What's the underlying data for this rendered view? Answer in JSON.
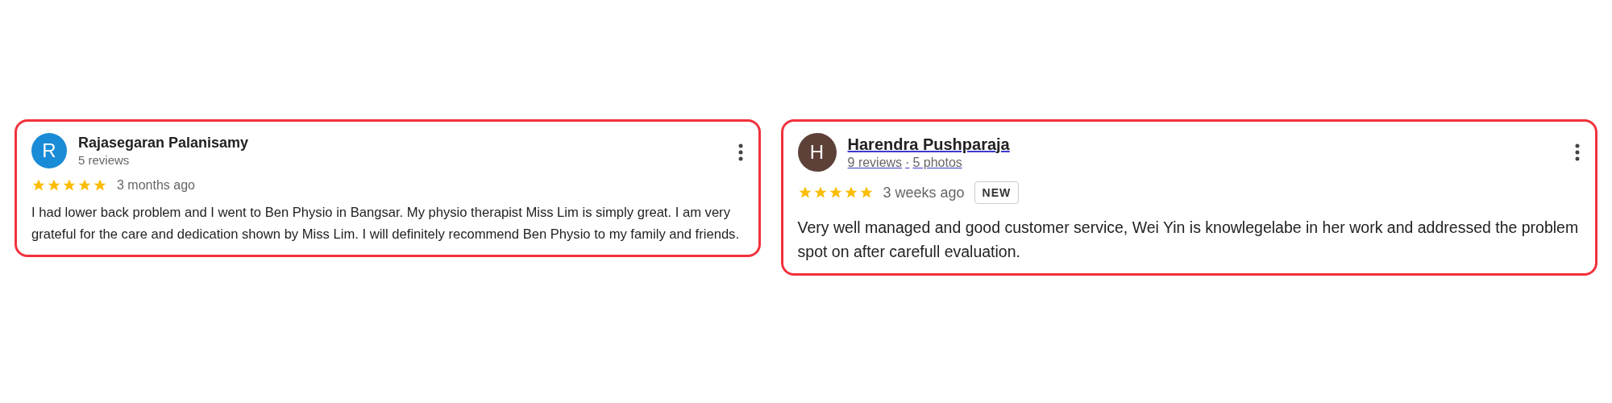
{
  "reviews": [
    {
      "avatar": {
        "letter": "R",
        "color": "#1a8bd6"
      },
      "name": "Rajasegaran Palanisamy",
      "linked": false,
      "meta": [
        "5 reviews"
      ],
      "stars": 5,
      "time": "3 months ago",
      "text": "I had lower back problem and I went to Ben Physio in Bangsar. My physio therapist Miss Lim is simply great. I am very grateful for the care and dedication shown by Miss Lim. I will definitely recommend Ben Physio to my family and friends.",
      "kind": "compact"
    },
    {
      "avatar": {
        "letter": "H",
        "color": "#5d4037"
      },
      "name": "Harendra Pushparaja",
      "linked": true,
      "meta": [
        "9 reviews",
        "5 photos"
      ],
      "meta_separator": "·",
      "stars": 5,
      "time": "3 weeks ago",
      "badge": "NEW",
      "text": "Very well managed and good customer service, Wei Yin is knowlegelabe in her work and addressed the problem spot on after carefull evaluation.",
      "kind": "large"
    }
  ]
}
